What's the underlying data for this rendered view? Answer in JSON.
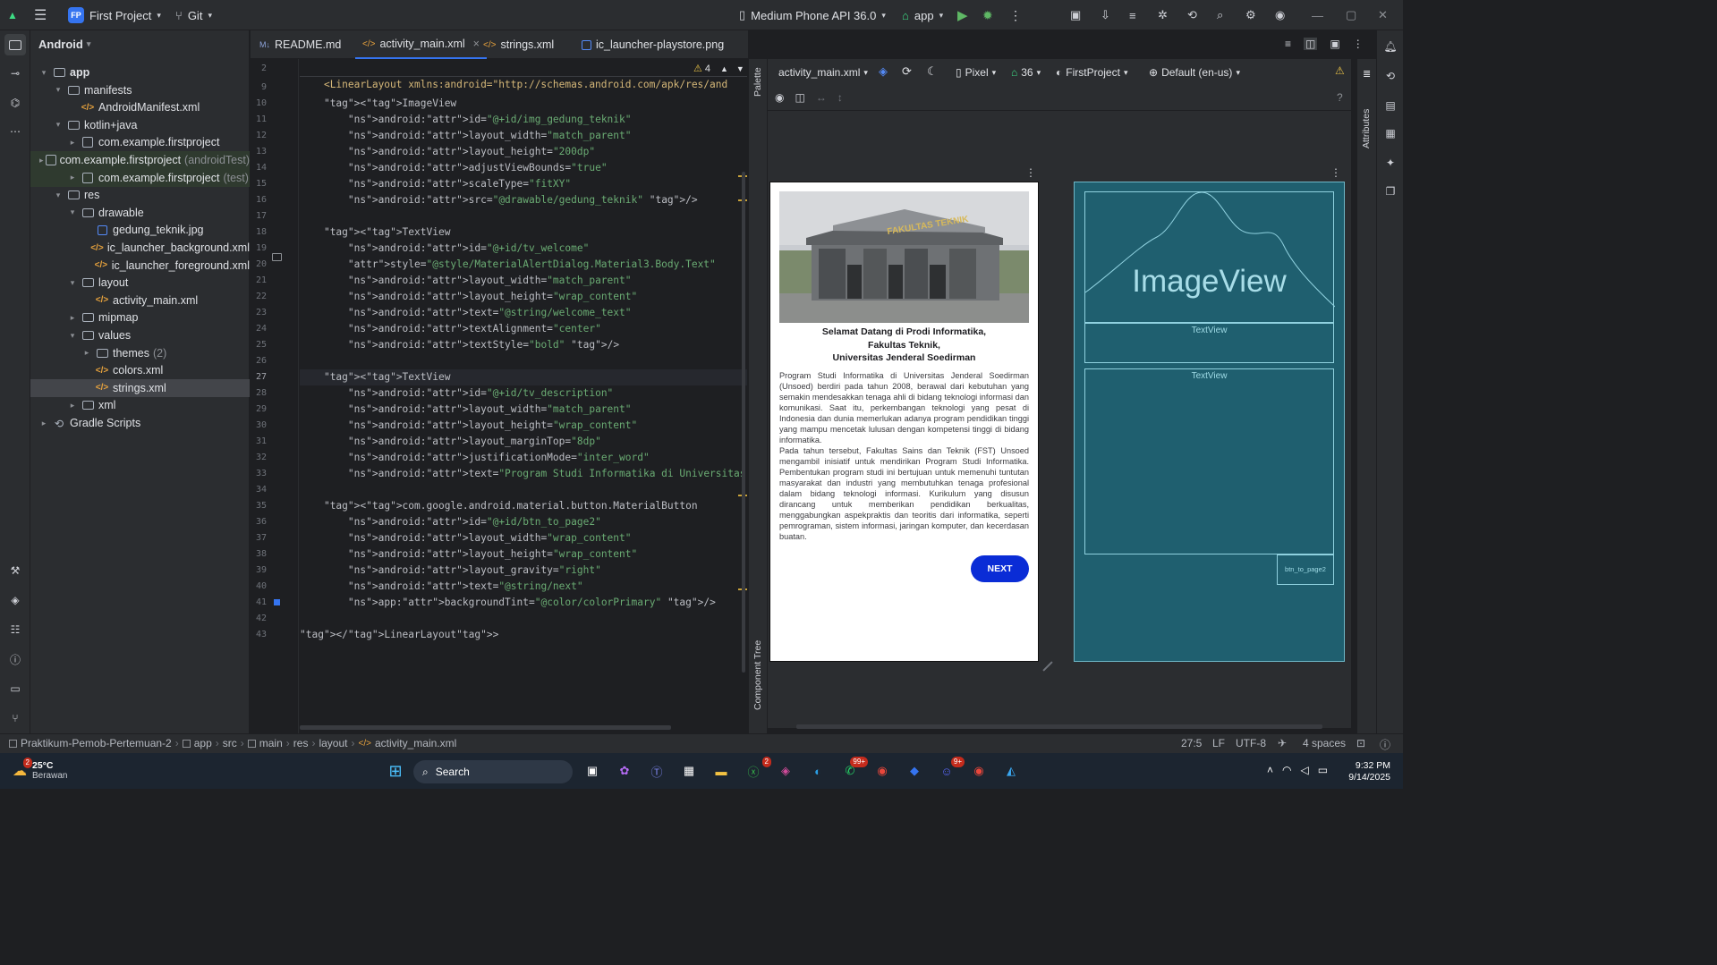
{
  "titlebar": {
    "project_name": "First Project",
    "project_badge": "FP",
    "vcs": "Git",
    "device": "Medium Phone API 36.0",
    "run_config": "app"
  },
  "project_panel": {
    "view_mode": "Android",
    "tree": [
      {
        "label": "app",
        "depth": 0,
        "kind": "module",
        "expanded": true
      },
      {
        "label": "manifests",
        "depth": 1,
        "kind": "folder",
        "expanded": true
      },
      {
        "label": "AndroidManifest.xml",
        "depth": 2,
        "kind": "xml"
      },
      {
        "label": "kotlin+java",
        "depth": 1,
        "kind": "folder",
        "expanded": true
      },
      {
        "label": "com.example.firstproject",
        "depth": 2,
        "kind": "package",
        "collapsed": true
      },
      {
        "label": "com.example.firstproject",
        "suffix": "(androidTest)",
        "depth": 2,
        "kind": "package",
        "collapsed": true,
        "highlight": true
      },
      {
        "label": "com.example.firstproject",
        "suffix": "(test)",
        "depth": 2,
        "kind": "package",
        "collapsed": true,
        "highlight": true
      },
      {
        "label": "res",
        "depth": 1,
        "kind": "folder",
        "expanded": true
      },
      {
        "label": "drawable",
        "depth": 2,
        "kind": "folder",
        "expanded": true
      },
      {
        "label": "gedung_teknik.jpg",
        "depth": 3,
        "kind": "image"
      },
      {
        "label": "ic_launcher_background.xml",
        "depth": 3,
        "kind": "xml"
      },
      {
        "label": "ic_launcher_foreground.xml",
        "depth": 3,
        "kind": "xml"
      },
      {
        "label": "layout",
        "depth": 2,
        "kind": "folder",
        "expanded": true
      },
      {
        "label": "activity_main.xml",
        "depth": 3,
        "kind": "xml"
      },
      {
        "label": "mipmap",
        "depth": 2,
        "kind": "folder",
        "collapsed": true
      },
      {
        "label": "values",
        "depth": 2,
        "kind": "folder",
        "expanded": true
      },
      {
        "label": "themes",
        "suffix": "(2)",
        "depth": 3,
        "kind": "folder",
        "collapsed": true
      },
      {
        "label": "colors.xml",
        "depth": 3,
        "kind": "xml"
      },
      {
        "label": "strings.xml",
        "depth": 3,
        "kind": "xml",
        "selected": true
      },
      {
        "label": "xml",
        "depth": 2,
        "kind": "folder",
        "collapsed": true
      },
      {
        "label": "Gradle Scripts",
        "depth": 0,
        "kind": "gradle",
        "collapsed": true
      }
    ]
  },
  "editor_tabs": [
    {
      "label": "README.md",
      "icon": "M↓"
    },
    {
      "label": "activity_main.xml",
      "icon": "</>",
      "active": true,
      "close": "×"
    },
    {
      "label": "strings.xml",
      "icon": "</>"
    },
    {
      "label": "ic_launcher-playstore.png",
      "icon": "img"
    }
  ],
  "editor": {
    "sticky_line": "2",
    "sticky_code": "<LinearLayout xmlns:android=\"http://schemas.android.com/apk/res/and",
    "warning_count": "4",
    "lines": [
      {
        "n": "9",
        "code": ""
      },
      {
        "n": "10",
        "code": "    <ImageView"
      },
      {
        "n": "11",
        "code": "        android:id=\"@+id/img_gedung_teknik\""
      },
      {
        "n": "12",
        "code": "        android:layout_width=\"match_parent\""
      },
      {
        "n": "13",
        "code": "        android:layout_height=\"200dp\""
      },
      {
        "n": "14",
        "code": "        android:adjustViewBounds=\"true\""
      },
      {
        "n": "15",
        "code": "        android:scaleType=\"fitXY\""
      },
      {
        "n": "16",
        "code": "        android:src=\"@drawable/gedung_teknik\" />"
      },
      {
        "n": "17",
        "code": ""
      },
      {
        "n": "18",
        "code": "    <TextView"
      },
      {
        "n": "19",
        "code": "        android:id=\"@+id/tv_welcome\""
      },
      {
        "n": "20",
        "code": "        style=\"@style/MaterialAlertDialog.Material3.Body.Text\""
      },
      {
        "n": "21",
        "code": "        android:layout_width=\"match_parent\""
      },
      {
        "n": "22",
        "code": "        android:layout_height=\"wrap_content\""
      },
      {
        "n": "23",
        "code": "        android:text=\"@string/welcome_text\""
      },
      {
        "n": "24",
        "code": "        android:textAlignment=\"center\""
      },
      {
        "n": "25",
        "code": "        android:textStyle=\"bold\" />"
      },
      {
        "n": "26",
        "code": ""
      },
      {
        "n": "27",
        "code": "    <TextView",
        "current": true
      },
      {
        "n": "28",
        "code": "        android:id=\"@+id/tv_description\""
      },
      {
        "n": "29",
        "code": "        android:layout_width=\"match_parent\""
      },
      {
        "n": "30",
        "code": "        android:layout_height=\"wrap_content\""
      },
      {
        "n": "31",
        "code": "        android:layout_marginTop=\"8dp\""
      },
      {
        "n": "32",
        "code": "        android:justificationMode=\"inter_word\""
      },
      {
        "n": "33",
        "code": "        android:text=\"Program Studi Informatika di Universitas Jenderal Soed"
      },
      {
        "n": "34",
        "code": ""
      },
      {
        "n": "35",
        "code": "    <com.google.android.material.button.MaterialButton"
      },
      {
        "n": "36",
        "code": "        android:id=\"@+id/btn_to_page2\""
      },
      {
        "n": "37",
        "code": "        android:layout_width=\"wrap_content\""
      },
      {
        "n": "38",
        "code": "        android:layout_height=\"wrap_content\""
      },
      {
        "n": "39",
        "code": "        android:layout_gravity=\"right\""
      },
      {
        "n": "40",
        "code": "        android:text=\"@string/next\""
      },
      {
        "n": "41",
        "code": "        app:backgroundTint=\"@color/colorPrimary\" />"
      },
      {
        "n": "42",
        "code": ""
      },
      {
        "n": "43",
        "code": "</LinearLayout>"
      }
    ]
  },
  "design_toolbar": {
    "file": "activity_main.xml",
    "device": "Pixel",
    "api": "36",
    "theme": "FirstProject",
    "locale": "Default (en-us)"
  },
  "side_labels": {
    "palette": "Palette",
    "component_tree": "Component Tree",
    "attributes": "Attributes"
  },
  "preview": {
    "welcome_text": "Selamat Datang di Prodi Informatika,\nFakultas Teknik,\nUniversitas Jenderal Soedirman",
    "description_p1": "Program Studi Informatika di Universitas Jenderal Soedirman (Unsoed) berdiri pada tahun 2008, berawal dari kebutuhan yang semakin mendesakkan tenaga ahli di bidang teknologi informasi dan komunikasi. Saat itu, perkembangan teknologi yang pesat di Indonesia dan dunia memerlukan adanya program pendidikan tinggi yang mampu mencetak lulusan dengan kompetensi tinggi di bidang informatika.",
    "description_p2": "Pada tahun tersebut, Fakultas Sains dan Teknik (FST) Unsoed mengambil inisiatif untuk mendirikan Program Studi Informatika. Pembentukan program studi ini bertujuan untuk memenuhi tuntutan masyarakat dan industri yang membutuhkan tenaga profesional dalam bidang teknologi informasi. Kurikulum yang disusun dirancang untuk memberikan pendidikan berkualitas, menggabungkan aspekpraktis dan teoritis dari informatika, seperti pemrograman, sistem informasi, jaringan komputer, dan kecerdasan buatan.",
    "button_label": "NEXT",
    "building_sign": "FAKULTAS TEKNIK"
  },
  "blueprint": {
    "imageview_label": "ImageView",
    "textview1_label": "TextView",
    "textview2_label": "TextView",
    "button_label": "btn_to_page2"
  },
  "statusbar": {
    "breadcrumb": [
      "Praktikum-Pemob-Pertemuan-2",
      "app",
      "src",
      "main",
      "res",
      "layout",
      "activity_main.xml"
    ],
    "position": "27:5",
    "line_sep": "LF",
    "encoding": "UTF-8",
    "indent": "4 spaces"
  },
  "taskbar": {
    "weather_temp": "25°C",
    "weather_desc": "Berawan",
    "weather_badge": "2",
    "search_label": "Search",
    "xbox_badge": "2",
    "whatsapp_badge": "99+",
    "discord_badge": "9+",
    "time": "9:32 PM",
    "date": "9/14/2025"
  },
  "colors": {
    "accent": "#3574f0",
    "button_primary": "#0a2cd6",
    "blueprint_bg": "#1f5f6f"
  }
}
